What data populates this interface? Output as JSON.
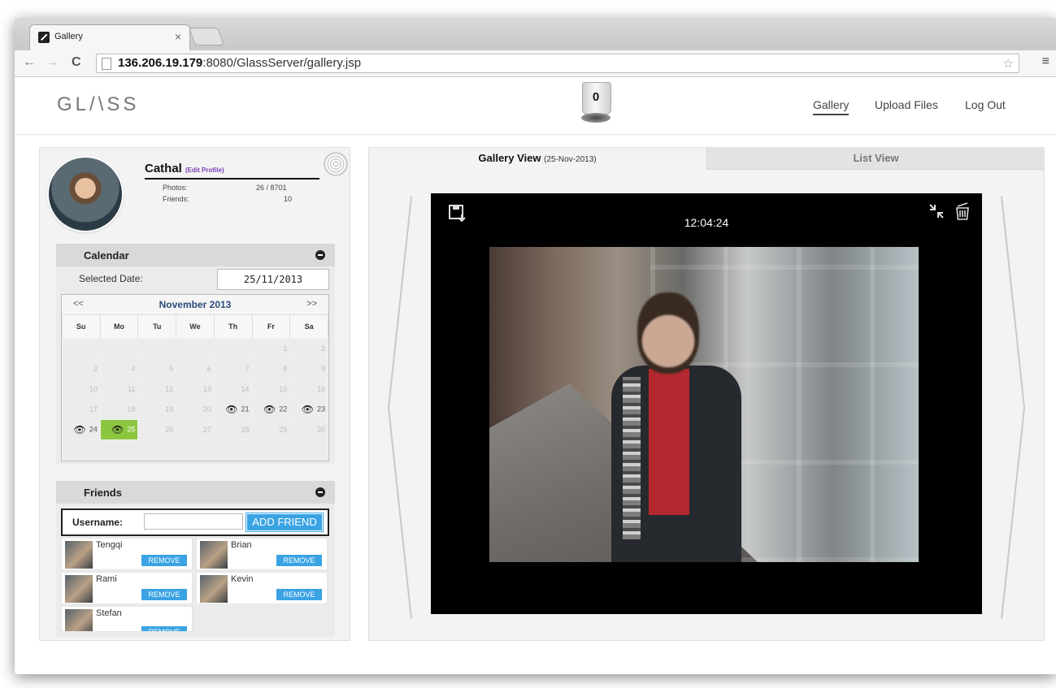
{
  "browser": {
    "tab_title": "Gallery",
    "tab_close": "×",
    "url_host": "136.206.19.179",
    "url_rest": ":8080/GlassServer/gallery.jsp",
    "back_icon": "←",
    "forward_icon": "→",
    "reload_icon": "C",
    "star_icon": "☆",
    "menu_icon": "≡"
  },
  "header": {
    "logo": "GL/\\SS",
    "trash_count": "0",
    "nav": [
      {
        "label": "Gallery",
        "active": true
      },
      {
        "label": "Upload Files",
        "active": false
      },
      {
        "label": "Log Out",
        "active": false
      }
    ]
  },
  "profile": {
    "name": "Cathal",
    "edit_label": "(Edit Profile)",
    "photos_label": "Photos:",
    "photos_value": "26 / 8701",
    "friends_label": "Friends:",
    "friends_value": "10"
  },
  "calendar": {
    "title": "Calendar",
    "selected_label": "Selected Date:",
    "selected_value": "25/11/2013",
    "prev": "<<",
    "next": ">>",
    "month": "November 2013",
    "weekdays": [
      "Su",
      "Mo",
      "Tu",
      "We",
      "Th",
      "Fr",
      "Sa"
    ]
  },
  "friends": {
    "title": "Friends",
    "username_label": "Username:",
    "add_label": "ADD FRIEND",
    "remove_label": "REMOVE",
    "list": [
      "Tengqi",
      "Brian",
      "Rami",
      "Kevin",
      "Stefan"
    ]
  },
  "gallery": {
    "tab_gallery": "Gallery View",
    "tab_gallery_date": "(25-Nov-2013)",
    "tab_list": "List View",
    "time": "12:04:24"
  }
}
